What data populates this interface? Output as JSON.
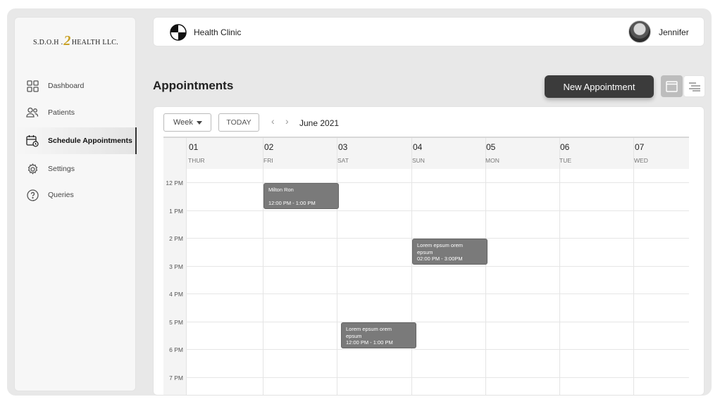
{
  "brand": {
    "logo_left": "S.D.O.H .",
    "logo_two": "2",
    "logo_right": "HEALTH LLC."
  },
  "sidebar": {
    "items": [
      {
        "label": "Dashboard",
        "icon": "grid-icon"
      },
      {
        "label": "Patients",
        "icon": "users-icon"
      },
      {
        "label": "Schedule Appointments",
        "icon": "calendar-clock-icon",
        "active": true
      },
      {
        "label": "Settings",
        "icon": "gear-icon"
      },
      {
        "label": "Queries",
        "icon": "question-icon"
      }
    ]
  },
  "header": {
    "clinic_name": "Health Clinic",
    "user_name": "Jennifer"
  },
  "page": {
    "title": "Appointments",
    "new_appointment_label": "New Appointment"
  },
  "calendar": {
    "view_select": "Week",
    "today_label": "TODAY",
    "prev_arrow": "‹",
    "next_arrow": "›",
    "month_label": "June 2021",
    "days": [
      {
        "num": "01",
        "name": "THUR"
      },
      {
        "num": "02",
        "name": "FRI"
      },
      {
        "num": "03",
        "name": "SAT"
      },
      {
        "num": "04",
        "name": "SUN"
      },
      {
        "num": "05",
        "name": "MON"
      },
      {
        "num": "06",
        "name": "TUE"
      },
      {
        "num": "07",
        "name": "WED"
      }
    ],
    "times": [
      "12 PM",
      "1 PM",
      "2 PM",
      "3 PM",
      "4 PM",
      "5 PM",
      "6 PM",
      "7 PM"
    ],
    "events": [
      {
        "title": "Milton Ron",
        "time": "12:00 PM - 1:00 PM",
        "day": "02"
      },
      {
        "title": "Lorem epsum orem epsum",
        "time": "02:00 PM - 3:00PM",
        "day": "04"
      },
      {
        "title": "Lorem epsum orem epsum",
        "time": "12:00 PM - 1:00 PM",
        "day": "03"
      }
    ]
  },
  "colors": {
    "accent_dark": "#3b3b3b",
    "event_fill": "#7a7a7a",
    "logo_gold": "#c9a227"
  }
}
